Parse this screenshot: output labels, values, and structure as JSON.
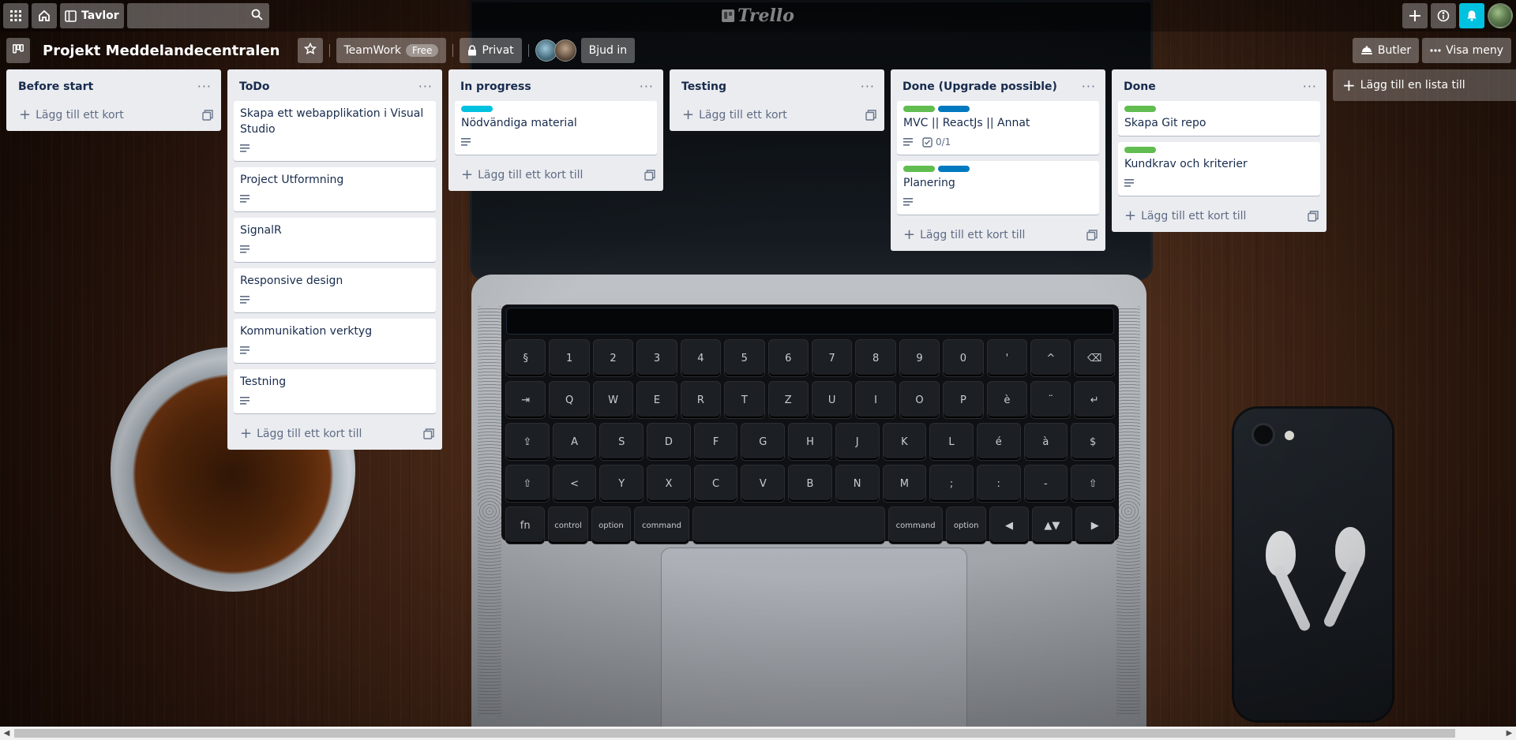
{
  "header": {
    "apps_icon": "grid-icon",
    "home_icon": "home-icon",
    "boards_label": "Tavlor",
    "search_placeholder": "",
    "logo_text": "Trello",
    "notification_color": "#00c2e0"
  },
  "board": {
    "title": "Projekt Meddelandecentralen",
    "team_label": "TeamWork",
    "team_badge": "Free",
    "visibility_label": "Privat",
    "invite_label": "Bjud in",
    "butler_label": "Butler",
    "menu_label": "Visa meny"
  },
  "lists": [
    {
      "title": "Before start",
      "cards": [],
      "add_label": "Lägg till ett kort"
    },
    {
      "title": "ToDo",
      "cards": [
        {
          "title": "Skapa ett webapplikation i Visual Studio",
          "labels": [],
          "description": true
        },
        {
          "title": "Project Utformning",
          "labels": [],
          "description": true
        },
        {
          "title": "SignalR",
          "labels": [],
          "description": true
        },
        {
          "title": "Responsive design",
          "labels": [],
          "description": true
        },
        {
          "title": "Kommunikation verktyg",
          "labels": [],
          "description": true
        },
        {
          "title": "Testning",
          "labels": [],
          "description": true
        }
      ],
      "add_label": "Lägg till ett kort till"
    },
    {
      "title": "In progress",
      "cards": [
        {
          "title": "Nödvändiga material",
          "labels": [
            "#00c2e0"
          ],
          "description": true
        }
      ],
      "add_label": "Lägg till ett kort till"
    },
    {
      "title": "Testing",
      "cards": [],
      "add_label": "Lägg till ett kort"
    },
    {
      "title": "Done (Upgrade possible)",
      "cards": [
        {
          "title": "MVC || ReactJs || Annat",
          "labels": [
            "#61bd4f",
            "#0079bf"
          ],
          "description": true,
          "checklist": "0/1"
        },
        {
          "title": "Planering",
          "labels": [
            "#61bd4f",
            "#0079bf"
          ],
          "description": true
        }
      ],
      "add_label": "Lägg till ett kort till"
    },
    {
      "title": "Done",
      "cards": [
        {
          "title": "Skapa Git repo",
          "labels": [
            "#61bd4f"
          ],
          "description": false
        },
        {
          "title": "Kundkrav och kriterier",
          "labels": [
            "#61bd4f"
          ],
          "description": true
        }
      ],
      "add_label": "Lägg till ett kort till"
    }
  ],
  "add_list_label": "Lägg till en lista till",
  "keyboard": {
    "rows": [
      [
        "§",
        "1",
        "2",
        "3",
        "4",
        "5",
        "6",
        "7",
        "8",
        "9",
        "0",
        "'",
        "^",
        "⌫"
      ],
      [
        "⇥",
        "Q",
        "W",
        "E",
        "R",
        "T",
        "Z",
        "U",
        "I",
        "O",
        "P",
        "è",
        "¨",
        "↵"
      ],
      [
        "⇪",
        "A",
        "S",
        "D",
        "F",
        "G",
        "H",
        "J",
        "K",
        "L",
        "é",
        "à",
        "$"
      ],
      [
        "⇧",
        "<",
        "Y",
        "X",
        "C",
        "V",
        "B",
        "N",
        "M",
        ";",
        ":",
        "-",
        "⇧"
      ],
      [
        "fn",
        "control",
        "option",
        "command",
        "",
        "command",
        "option",
        "◀",
        "▲▼",
        "▶"
      ]
    ]
  }
}
